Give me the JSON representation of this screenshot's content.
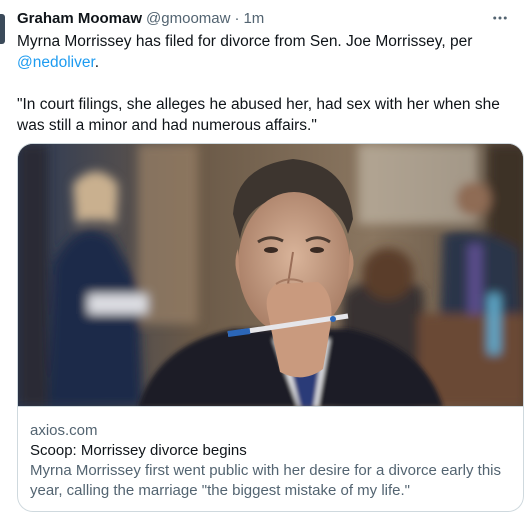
{
  "tweet": {
    "author_name": "Graham Moomaw",
    "handle": "@gmoomaw",
    "separator": "·",
    "time": "1m",
    "line1": "Myrna Morrissey has filed for divorce from Sen. Joe Morrissey, per",
    "mention": "@nedoliver",
    "mention_suffix": ".",
    "quote": "\"In court filings, she alleges he abused her, had sex with her when she was still a minor and had numerous affairs.\""
  },
  "card": {
    "domain": "axios.com",
    "title": "Scoop: Morrissey divorce begins",
    "description": "Myrna Morrissey first went public with her desire for a divorce early this year, calling the marriage \"the biggest mistake of my life.\""
  },
  "icons": {
    "more": "more-options-icon"
  }
}
